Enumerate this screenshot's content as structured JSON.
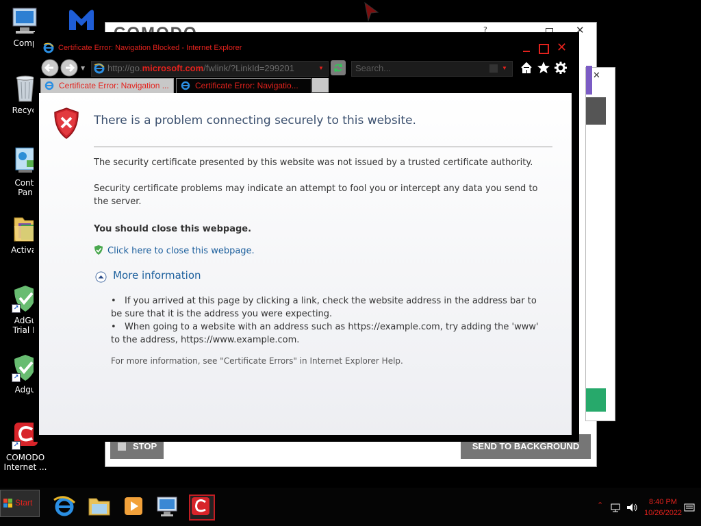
{
  "desktop": {
    "icons": [
      {
        "label": "Comp",
        "icon": "computer-icon"
      },
      {
        "label": "Recycl",
        "icon": "recycle-bin-icon"
      },
      {
        "label": "Conti\nPan",
        "icon": "control-panel-icon"
      },
      {
        "label": "Activat",
        "icon": "folder-icon"
      },
      {
        "label": "AdGu\nTrial R",
        "icon": "adguard-shield-icon"
      },
      {
        "label": "Adgu",
        "icon": "adguard-shield-icon"
      },
      {
        "label": "COMODO\nInternet ...",
        "icon": "comodo-icon"
      }
    ]
  },
  "comodo_window": {
    "logo": "COMODO",
    "stop_label": "STOP",
    "send_label": "SEND TO BACKGROUND"
  },
  "browser": {
    "title": "Certificate Error: Navigation Blocked - Internet Explorer",
    "url_prefix": "http://go.",
    "url_domain": "microsoft.com",
    "url_suffix": "/fwlink/?LinkId=299201",
    "search_placeholder": "Search...",
    "tabs": [
      {
        "label": "Certificate Error: Navigation ..."
      },
      {
        "label": "Certificate Error: Navigatio..."
      }
    ]
  },
  "page": {
    "heading": "There is a problem connecting securely to this website.",
    "para1": "The security certificate presented by this website was not issued by a trusted certificate authority.",
    "para2": "Security certificate problems may indicate an attempt to fool you or intercept any data you send to the server.",
    "recommendation": "You should close this webpage.",
    "close_link": "Click here to close this webpage.",
    "more_info": "More information",
    "bullet1": "If you arrived at this page by clicking a link, check the website address in the address bar to be sure that it is the address you were expecting.",
    "bullet2": "When going to a website with an address such as https://example.com, try adding the 'www' to the address, https://www.example.com.",
    "footer": "For more information, see \"Certificate Errors\" in Internet Explorer Help."
  },
  "taskbar": {
    "start_label": "Start",
    "time": "8:40 PM",
    "date": "10/26/2022"
  },
  "colors": {
    "accent": "#e3221d",
    "link": "#1a5e9c",
    "comodo_purple": "#7b5cc4",
    "comodo_green": "#27a96b"
  }
}
